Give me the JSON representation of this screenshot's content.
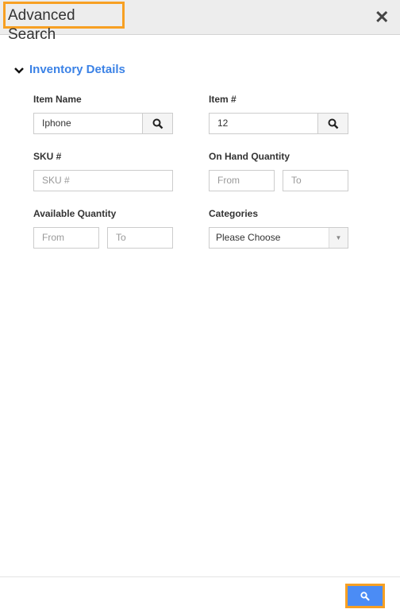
{
  "header": {
    "title": "Advanced Search",
    "close_icon": "close-icon"
  },
  "section": {
    "title": "Inventory Details",
    "icon": "chevron-down-icon"
  },
  "fields": {
    "item_name": {
      "label": "Item Name",
      "value": "Iphone"
    },
    "item_no": {
      "label": "Item #",
      "value": "12"
    },
    "sku": {
      "label": "SKU #",
      "placeholder": "SKU #"
    },
    "on_hand": {
      "label": "On Hand Quantity",
      "from_placeholder": "From",
      "to_placeholder": "To"
    },
    "available": {
      "label": "Available Quantity",
      "from_placeholder": "From",
      "to_placeholder": "To"
    },
    "categories": {
      "label": "Categories",
      "value": "Please Choose"
    }
  },
  "footer": {
    "search_icon": "search-icon",
    "accent": "#4b8cf5",
    "highlight": "#f7a023"
  }
}
